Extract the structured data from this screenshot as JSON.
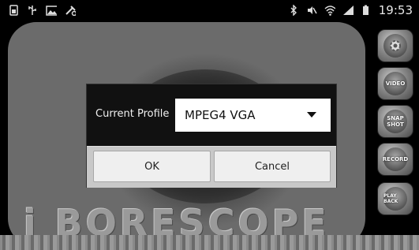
{
  "status_bar": {
    "time": "19:53",
    "left_icons": [
      "sim-icon",
      "usb-icon",
      "image-icon",
      "tools-icon"
    ],
    "right_icons": [
      "bluetooth-icon",
      "mute-icon",
      "wifi-icon",
      "signal-icon",
      "battery-icon"
    ]
  },
  "app": {
    "brand": "i BORESCOPE"
  },
  "side_buttons": [
    {
      "name": "settings-button",
      "label": ""
    },
    {
      "name": "video-button",
      "label": "VIDEO"
    },
    {
      "name": "snapshot-button",
      "label": "SNAP SHOT"
    },
    {
      "name": "record-button",
      "label": "RECORD"
    },
    {
      "name": "playback-button",
      "label": "PLAY BACK"
    }
  ],
  "dialog": {
    "profile_label": "Current Profile",
    "profile_value": "MPEG4 VGA",
    "ok_label": "OK",
    "cancel_label": "Cancel"
  }
}
